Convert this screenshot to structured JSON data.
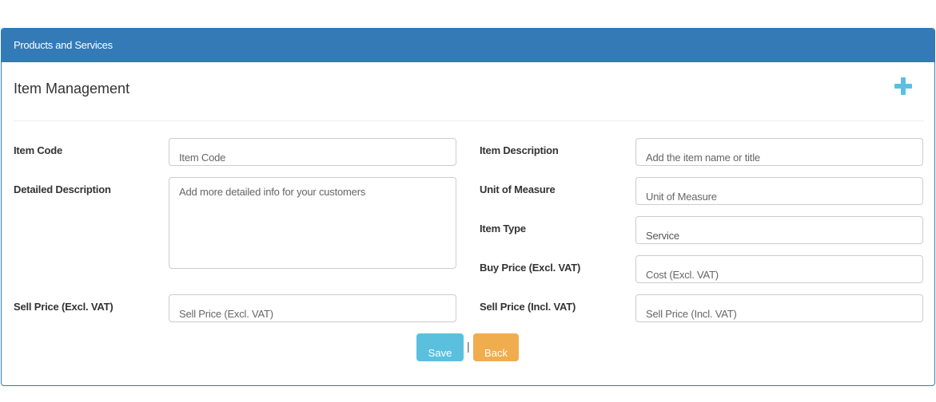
{
  "panel": {
    "heading": "Products and Services",
    "section_title": "Item Management"
  },
  "icons": {
    "add": "plus-icon"
  },
  "form": {
    "item_code": {
      "label": "Item Code",
      "placeholder": "Item Code"
    },
    "item_description": {
      "label": "Item Description",
      "placeholder": "Add the item name or title"
    },
    "detailed_description": {
      "label": "Detailed Description",
      "placeholder": "Add more detailed info for your customers"
    },
    "unit_of_measure": {
      "label": "Unit of Measure",
      "placeholder": "Unit of Measure"
    },
    "item_type": {
      "label": "Item Type",
      "value": "Service"
    },
    "buy_price": {
      "label": "Buy Price (Excl. VAT)",
      "placeholder": "Cost (Excl. VAT)"
    },
    "sell_price_excl": {
      "label": "Sell Price (Excl. VAT)",
      "placeholder": "Sell Price (Excl. VAT)"
    },
    "sell_price_incl": {
      "label": "Sell Price (Incl. VAT)",
      "placeholder": "Sell Price (Incl. VAT)"
    }
  },
  "actions": {
    "save_label": "Save",
    "separator": "|",
    "back_label": "Back"
  },
  "colors": {
    "primary": "#337ab7",
    "info": "#5bc0de",
    "warning": "#f0ad4e"
  }
}
